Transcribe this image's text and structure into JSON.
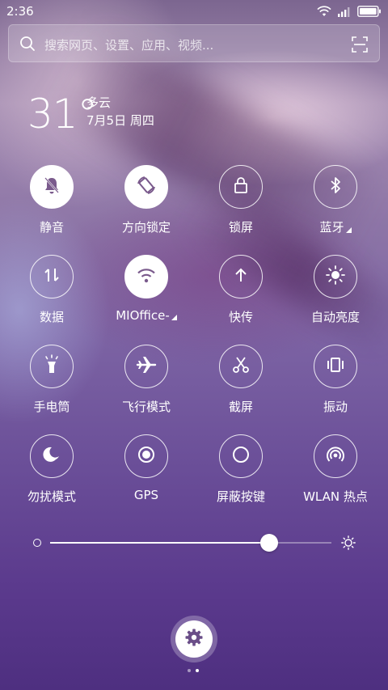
{
  "status_bar": {
    "time": "2:36",
    "icons": [
      "wifi-icon",
      "signal-icon",
      "battery-icon"
    ]
  },
  "search": {
    "placeholder": "搜索网页、设置、应用、视频...",
    "icons": [
      "search-icon",
      "scan-icon"
    ]
  },
  "weather": {
    "temperature": "31°",
    "condition": "多云",
    "date": "7月5日 周四"
  },
  "toggles": [
    {
      "label": "静音",
      "icon": "mute-bell-icon",
      "active": true
    },
    {
      "label": "方向锁定",
      "icon": "rotation-lock-icon",
      "active": true
    },
    {
      "label": "锁屏",
      "icon": "lock-icon",
      "active": false
    },
    {
      "label": "蓝牙",
      "icon": "bluetooth-icon",
      "active": false,
      "has_more": true
    },
    {
      "label": "数据",
      "icon": "mobile-data-icon",
      "active": false
    },
    {
      "label": "MIOffice-",
      "icon": "wifi-icon",
      "active": true,
      "has_more": true
    },
    {
      "label": "快传",
      "icon": "upload-arrow-icon",
      "active": false
    },
    {
      "label": "自动亮度",
      "icon": "auto-brightness-icon",
      "active": false
    },
    {
      "label": "手电筒",
      "icon": "flashlight-icon",
      "active": false
    },
    {
      "label": "飞行模式",
      "icon": "airplane-icon",
      "active": false
    },
    {
      "label": "截屏",
      "icon": "scissors-icon",
      "active": false
    },
    {
      "label": "振动",
      "icon": "vibrate-icon",
      "active": false
    },
    {
      "label": "勿扰模式",
      "icon": "moon-icon",
      "active": false
    },
    {
      "label": "GPS",
      "icon": "gps-icon",
      "active": false
    },
    {
      "label": "屏蔽按键",
      "icon": "block-keys-icon",
      "active": false
    },
    {
      "label": "WLAN 热点",
      "icon": "hotspot-icon",
      "active": false
    }
  ],
  "brightness": {
    "level": 0.78,
    "icons": [
      "brightness-low-icon",
      "brightness-high-icon"
    ]
  },
  "settings": {
    "icon": "gear-icon"
  },
  "pager": {
    "pages": 2,
    "current": 2
  },
  "colors": {
    "background_top": "#7c6690",
    "background_bottom": "#4e2f80",
    "active_circle": "#ffffff",
    "icon_on_active": "#7a5a8c"
  }
}
